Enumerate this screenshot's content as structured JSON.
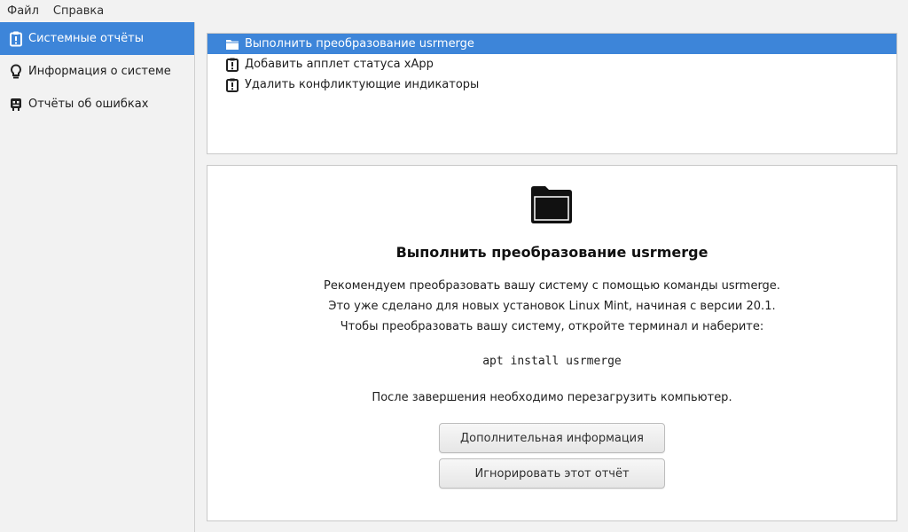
{
  "menu": {
    "file": "Файл",
    "help": "Справка"
  },
  "sidebar": {
    "items": [
      {
        "label": "Системные отчёты",
        "icon": "clipboard-alert-icon",
        "active": true
      },
      {
        "label": "Информация о системе",
        "icon": "lightbulb-icon",
        "active": false
      },
      {
        "label": "Отчёты об ошибках",
        "icon": "bug-report-icon",
        "active": false
      }
    ]
  },
  "reports": {
    "items": [
      {
        "label": "Выполнить преобразование usrmerge",
        "icon": "folder-icon",
        "selected": true
      },
      {
        "label": "Добавить апплет статуса xApp",
        "icon": "clipboard-alert-icon",
        "selected": false
      },
      {
        "label": "Удалить конфликтующие индикаторы",
        "icon": "clipboard-alert-icon",
        "selected": false
      }
    ]
  },
  "detail": {
    "icon": "folder-icon",
    "title": "Выполнить преобразование usrmerge",
    "lines": [
      "Рекомендуем преобразовать вашу систему с помощью команды usrmerge.",
      "Это уже сделано для новых установок Linux Mint, начиная с версии 20.1.",
      "Чтобы преобразовать вашу систему, откройте терминал и наберите:"
    ],
    "command": "apt install usrmerge",
    "footer": "После завершения необходимо перезагрузить компьютер.",
    "more_info_button": "Дополнительная информация",
    "ignore_button": "Игнорировать этот отчёт"
  },
  "colors": {
    "accent": "#3d85d9",
    "background": "#f2f2f2",
    "panel": "#ffffff"
  }
}
